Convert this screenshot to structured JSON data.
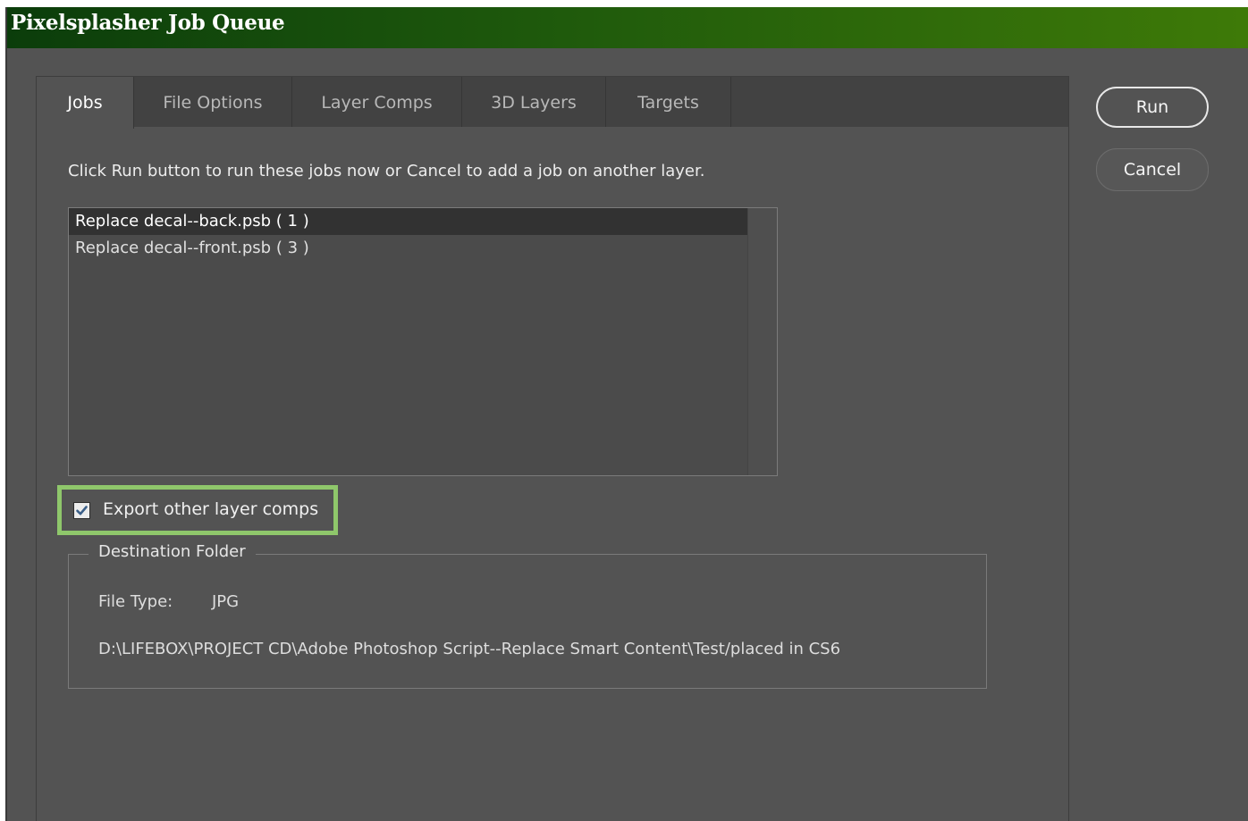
{
  "window": {
    "title": "Pixelsplasher Job Queue"
  },
  "tabs": [
    {
      "label": "Jobs",
      "active": true
    },
    {
      "label": "File Options",
      "active": false
    },
    {
      "label": "Layer Comps",
      "active": false
    },
    {
      "label": "3D Layers",
      "active": false
    },
    {
      "label": "Targets",
      "active": false
    }
  ],
  "jobs": {
    "instructions": "Click Run button to run these jobs now or Cancel to add a job on another layer.",
    "items": [
      {
        "label": "Replace decal--back.psb ( 1 )",
        "selected": true
      },
      {
        "label": "Replace decal--front.psb ( 3 )",
        "selected": false
      }
    ],
    "export_other_layer_comps": {
      "label": "Export other layer comps",
      "checked": true
    }
  },
  "destination": {
    "legend": "Destination Folder",
    "file_type_label": "File Type:",
    "file_type_value": "JPG",
    "path": "D:\\LIFEBOX\\PROJECT CD\\Adobe Photoshop Script--Replace Smart Content\\Test/placed in CS6"
  },
  "buttons": {
    "run_label": "Run",
    "cancel_label": "Cancel"
  },
  "colors": {
    "highlight_border": "#8fc76b",
    "title_gradient_start": "#0b3d0b",
    "title_gradient_end": "#3e7a08",
    "dialog_background": "#535353"
  }
}
